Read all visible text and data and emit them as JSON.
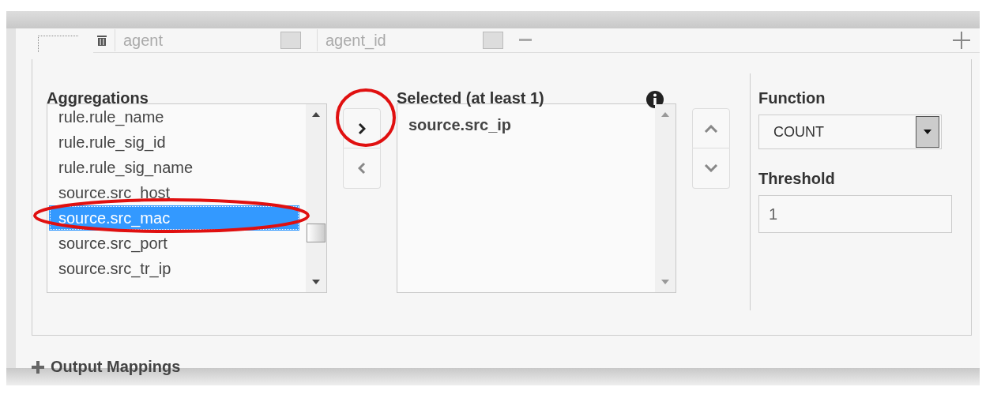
{
  "filter_row": {
    "field": "agent",
    "value": "agent_id"
  },
  "aggregations": {
    "label": "Aggregations",
    "items": [
      {
        "text": "rule.rule_name",
        "selected": false
      },
      {
        "text": "rule.rule_sig_id",
        "selected": false
      },
      {
        "text": "rule.rule_sig_name",
        "selected": false
      },
      {
        "text": "source.src_host",
        "selected": false
      },
      {
        "text": "source.src_mac",
        "selected": true
      },
      {
        "text": "source.src_port",
        "selected": false
      },
      {
        "text": "source.src_tr_ip",
        "selected": false
      }
    ]
  },
  "selected_list": {
    "label": "Selected (at least 1)",
    "items": [
      "source.src_ip"
    ]
  },
  "function": {
    "label": "Function",
    "value": "COUNT"
  },
  "threshold": {
    "label": "Threshold",
    "value": "1"
  },
  "output_mappings": {
    "label": "Output Mappings",
    "expanded": false
  }
}
